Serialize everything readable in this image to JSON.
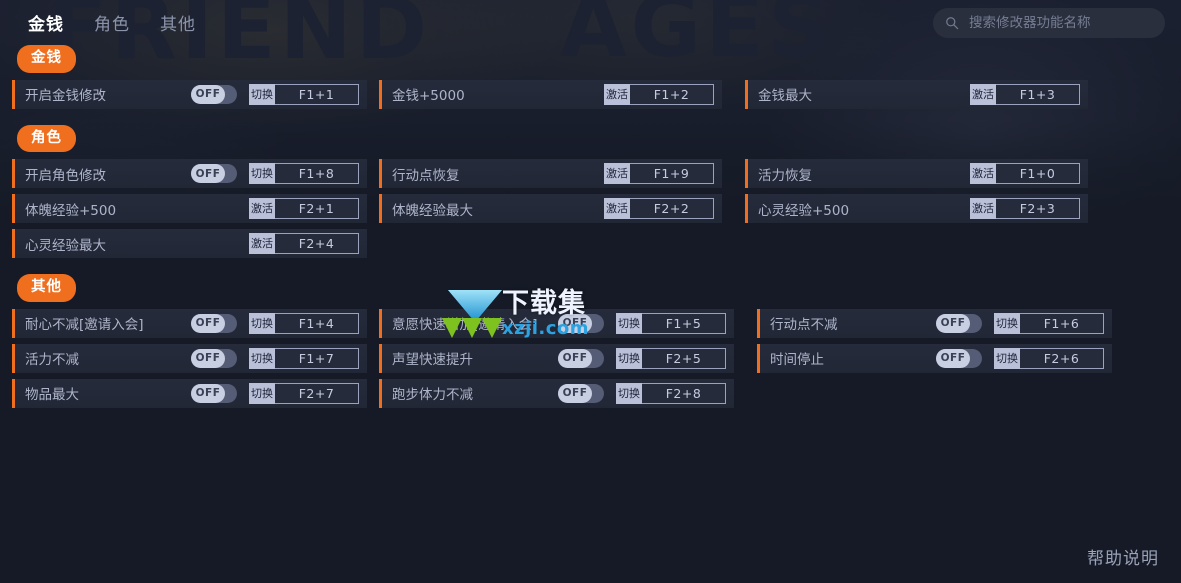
{
  "window": {
    "help_label": "帮助说明"
  },
  "header": {
    "tabs": [
      {
        "label": "金钱",
        "active": true
      },
      {
        "label": "角色",
        "active": false
      },
      {
        "label": "其他",
        "active": false
      }
    ],
    "search": {
      "placeholder": "搜索修改器功能名称",
      "value": "",
      "icon": "search-icon"
    }
  },
  "background": {
    "glyph_1": "FRIEND",
    "glyph_2": "AGES"
  },
  "watermark": {
    "title": "下载集",
    "url": "xzji.com"
  },
  "colors": {
    "accent": "#ef6f1f",
    "page_bg": "#151a26",
    "row_bg": "#252b3b",
    "toggle_on_track": "#545c76",
    "toggle_knob": "#c9cfe2",
    "hotkey_badge": "#b9c0d8"
  },
  "sections": [
    {
      "id": "money",
      "title": "金钱",
      "rows": [
        [
          {
            "name": "开启金钱修改",
            "toggle": "OFF",
            "action": "切换",
            "hotkey": "F1+1",
            "width": "wide"
          },
          {
            "name": "金钱+5000",
            "toggle": null,
            "action": "激活",
            "hotkey": "F1+2",
            "width": "narrow"
          },
          {
            "name": "金钱最大",
            "toggle": null,
            "action": "激活",
            "hotkey": "F1+3",
            "width": "narrow"
          }
        ]
      ]
    },
    {
      "id": "character",
      "title": "角色",
      "rows": [
        [
          {
            "name": "开启角色修改",
            "toggle": "OFF",
            "action": "切换",
            "hotkey": "F1+8",
            "width": "wide"
          },
          {
            "name": "行动点恢复",
            "toggle": null,
            "action": "激活",
            "hotkey": "F1+9",
            "width": "narrow"
          },
          {
            "name": "活力恢复",
            "toggle": null,
            "action": "激活",
            "hotkey": "F1+0",
            "width": "narrow"
          }
        ],
        [
          {
            "name": "体魄经验+500",
            "toggle": null,
            "action": "激活",
            "hotkey": "F2+1",
            "width": "wide"
          },
          {
            "name": "体魄经验最大",
            "toggle": null,
            "action": "激活",
            "hotkey": "F2+2",
            "width": "narrow"
          },
          {
            "name": "心灵经验+500",
            "toggle": null,
            "action": "激活",
            "hotkey": "F2+3",
            "width": "narrow"
          }
        ],
        [
          {
            "name": "心灵经验最大",
            "toggle": null,
            "action": "激活",
            "hotkey": "F2+4",
            "width": "wide"
          }
        ]
      ]
    },
    {
      "id": "other",
      "title": "其他",
      "rows": [
        [
          {
            "name": "耐心不减[邀请入会]",
            "toggle": "OFF",
            "action": "切换",
            "hotkey": "F1+4",
            "width": "wide"
          },
          {
            "name": "意愿快速增加[邀请入会]",
            "toggle": "OFF",
            "action": "切换",
            "hotkey": "F1+5",
            "width": "wide"
          },
          {
            "name": "行动点不减",
            "toggle": "OFF",
            "action": "切换",
            "hotkey": "F1+6",
            "width": "wide"
          }
        ],
        [
          {
            "name": "活力不减",
            "toggle": "OFF",
            "action": "切换",
            "hotkey": "F1+7",
            "width": "wide"
          },
          {
            "name": "声望快速提升",
            "toggle": "OFF",
            "action": "切换",
            "hotkey": "F2+5",
            "width": "wide"
          },
          {
            "name": "时间停止",
            "toggle": "OFF",
            "action": "切换",
            "hotkey": "F2+6",
            "width": "wide"
          }
        ],
        [
          {
            "name": "物品最大",
            "toggle": "OFF",
            "action": "切换",
            "hotkey": "F2+7",
            "width": "wide"
          },
          {
            "name": "跑步体力不减",
            "toggle": "OFF",
            "action": "切换",
            "hotkey": "F2+8",
            "width": "wide"
          }
        ]
      ]
    }
  ]
}
